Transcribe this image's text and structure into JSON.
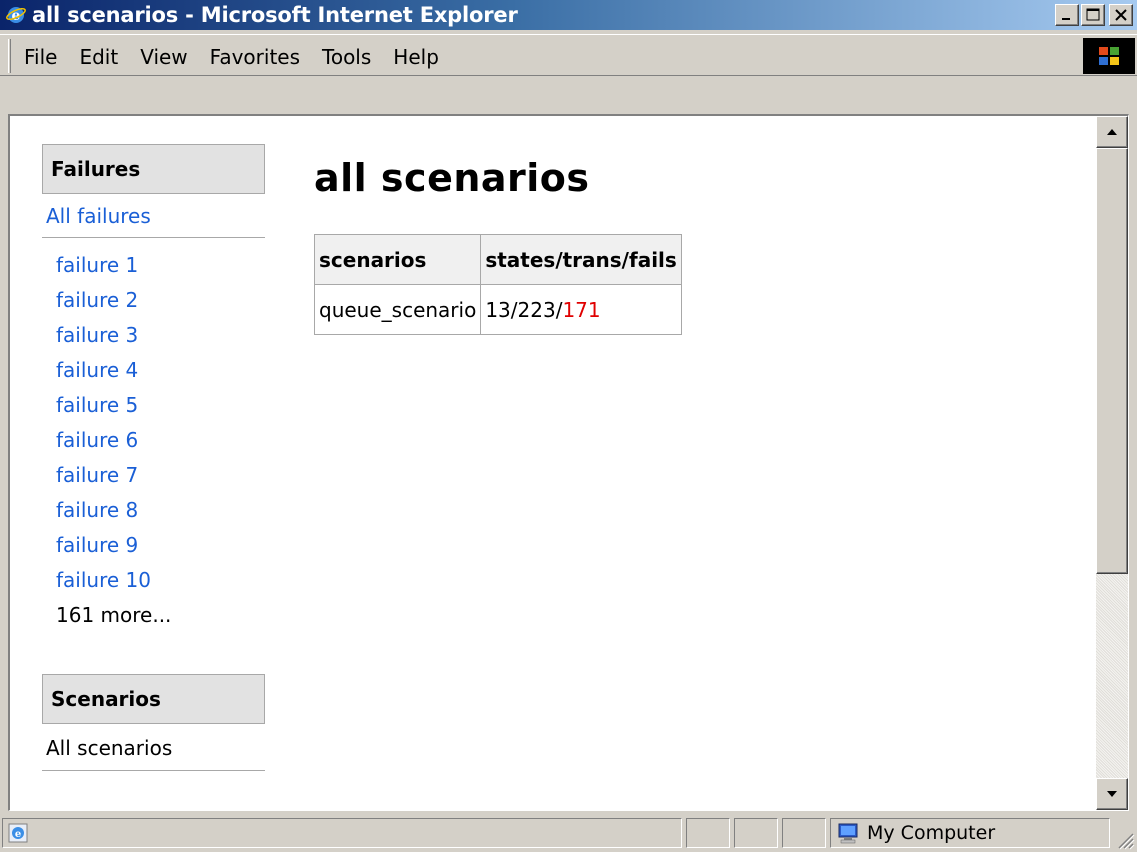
{
  "window": {
    "title": "all scenarios - Microsoft Internet Explorer",
    "buttons": [
      "minimize",
      "maximize",
      "close"
    ]
  },
  "menu": {
    "items": [
      "File",
      "Edit",
      "View",
      "Favorites",
      "Tools",
      "Help"
    ]
  },
  "sidebar": {
    "failures_heading": "Failures",
    "all_failures": "All failures",
    "failures": [
      "failure 1",
      "failure 2",
      "failure 3",
      "failure 4",
      "failure 5",
      "failure 6",
      "failure 7",
      "failure 8",
      "failure 9",
      "failure 10"
    ],
    "more": "161 more...",
    "scenarios_heading": "Scenarios",
    "all_scenarios": "All scenarios"
  },
  "main": {
    "title": "all scenarios",
    "table": {
      "headers": [
        "scenarios",
        "states/trans/fails"
      ],
      "rows": [
        {
          "scenario": "queue_scenario",
          "counts_prefix": "13/223/",
          "fails": "171"
        }
      ]
    }
  },
  "status": {
    "zone": "My Computer"
  },
  "colors": {
    "link": "#1a5fd6",
    "fails": "#e00000",
    "titlebar_start": "#0a246a",
    "titlebar_end": "#a6caf0"
  }
}
